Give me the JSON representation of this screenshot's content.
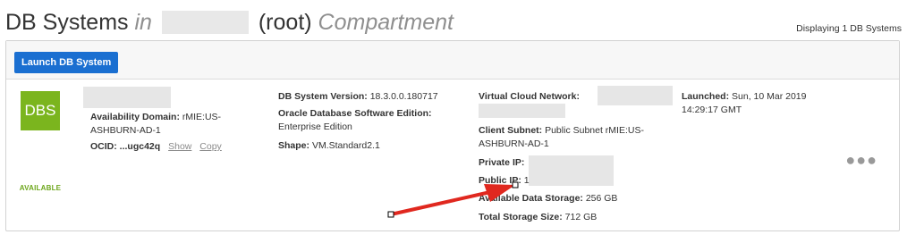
{
  "header": {
    "title_main": "DB Systems",
    "title_in": "in",
    "title_root": "(root)",
    "title_compartment": "Compartment",
    "count_text": "Displaying 1 DB Systems"
  },
  "toolbar": {
    "launch_label": "Launch DB System"
  },
  "db_system": {
    "icon_text": "DBS",
    "status": "AVAILABLE",
    "availability_domain_label": "Availability Domain:",
    "availability_domain_value_1": "rMIE:US-",
    "availability_domain_value_2": "ASHBURN-AD-1",
    "ocid_label": "OCID:",
    "ocid_value": "...ugc42q",
    "ocid_show": "Show",
    "ocid_copy": "Copy",
    "version_label": "DB System Version:",
    "version_value": "18.3.0.0.180717",
    "edition_label": "Oracle Database Software Edition:",
    "edition_value": "Enterprise Edition",
    "shape_label": "Shape:",
    "shape_value": "VM.Standard2.1",
    "vcn_label": "Virtual Cloud Network:",
    "subnet_label": "Client Subnet:",
    "subnet_value_1": "Public Subnet rMIE:US-",
    "subnet_value_2": "ASHBURN-AD-1",
    "private_ip_label": "Private IP:",
    "public_ip_label": "Public IP:",
    "public_ip_value": "1",
    "available_storage_label": "Available Data Storage:",
    "available_storage_value": "256 GB",
    "total_storage_label": "Total Storage Size:",
    "total_storage_value": "712 GB",
    "launched_label": "Launched:",
    "launched_value_1": "Sun, 10 Mar 2019",
    "launched_value_2": "14:29:17 GMT"
  },
  "colors": {
    "accent": "#1a6fd1",
    "status": "#7bb51e",
    "annotation_arrow": "#e0281f"
  },
  "icons": [
    "more-icon"
  ]
}
